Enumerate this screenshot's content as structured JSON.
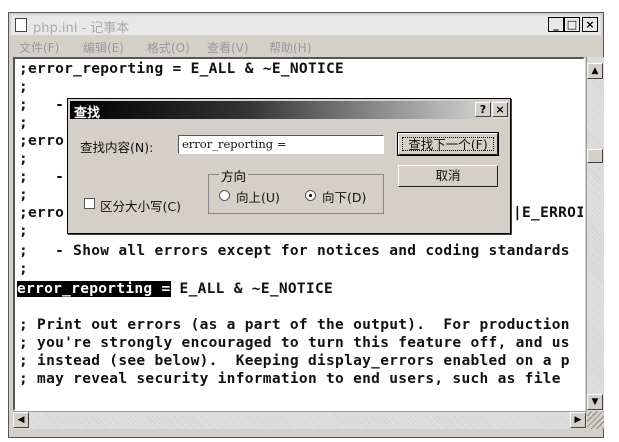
{
  "window": {
    "title": "php.ini - 记事本",
    "minimize": "_",
    "maximize": "□",
    "close": "×"
  },
  "menu": [
    "文件(F)",
    "编辑(E)",
    "格式(O)",
    "查看(V)",
    "帮助(H)"
  ],
  "editor": {
    "lines": [
      ";error_reporting = E_ALL & ~E_NOTICE",
      ";",
      ";   -",
      ";",
      ";erro",
      ";",
      ";   -",
      ";",
      ";erro",
      ";",
      ";   - Show all errors except for notices and coding standards",
      ";",
      "",
      "",
      "; Print out errors (as a part of the output).  For production",
      "; you're strongly encouraged to turn this feature off, and us",
      "; instead (see below).  Keeping display_errors enabled on a p",
      "; may reveal security information to end users, such as file"
    ],
    "partial_right": "|E_ERROI",
    "highlight_text": "error_reporting =",
    "highlight_rest": " E_ALL & ~E_NOTICE"
  },
  "scroll": {
    "up": "▲",
    "down": "▼",
    "left": "◀",
    "right": "▶"
  },
  "find_dialog": {
    "title": "查找",
    "help": "?",
    "close": "×",
    "find_label": "查找内容(N):",
    "find_value": "error_reporting =",
    "find_next": "查找下一个(F)",
    "cancel": "取消",
    "match_case": "区分大小写(C)",
    "match_case_checked": false,
    "direction_label": "方向",
    "up": "向上(U)",
    "down": "向下(D)",
    "direction_selected": "down"
  }
}
